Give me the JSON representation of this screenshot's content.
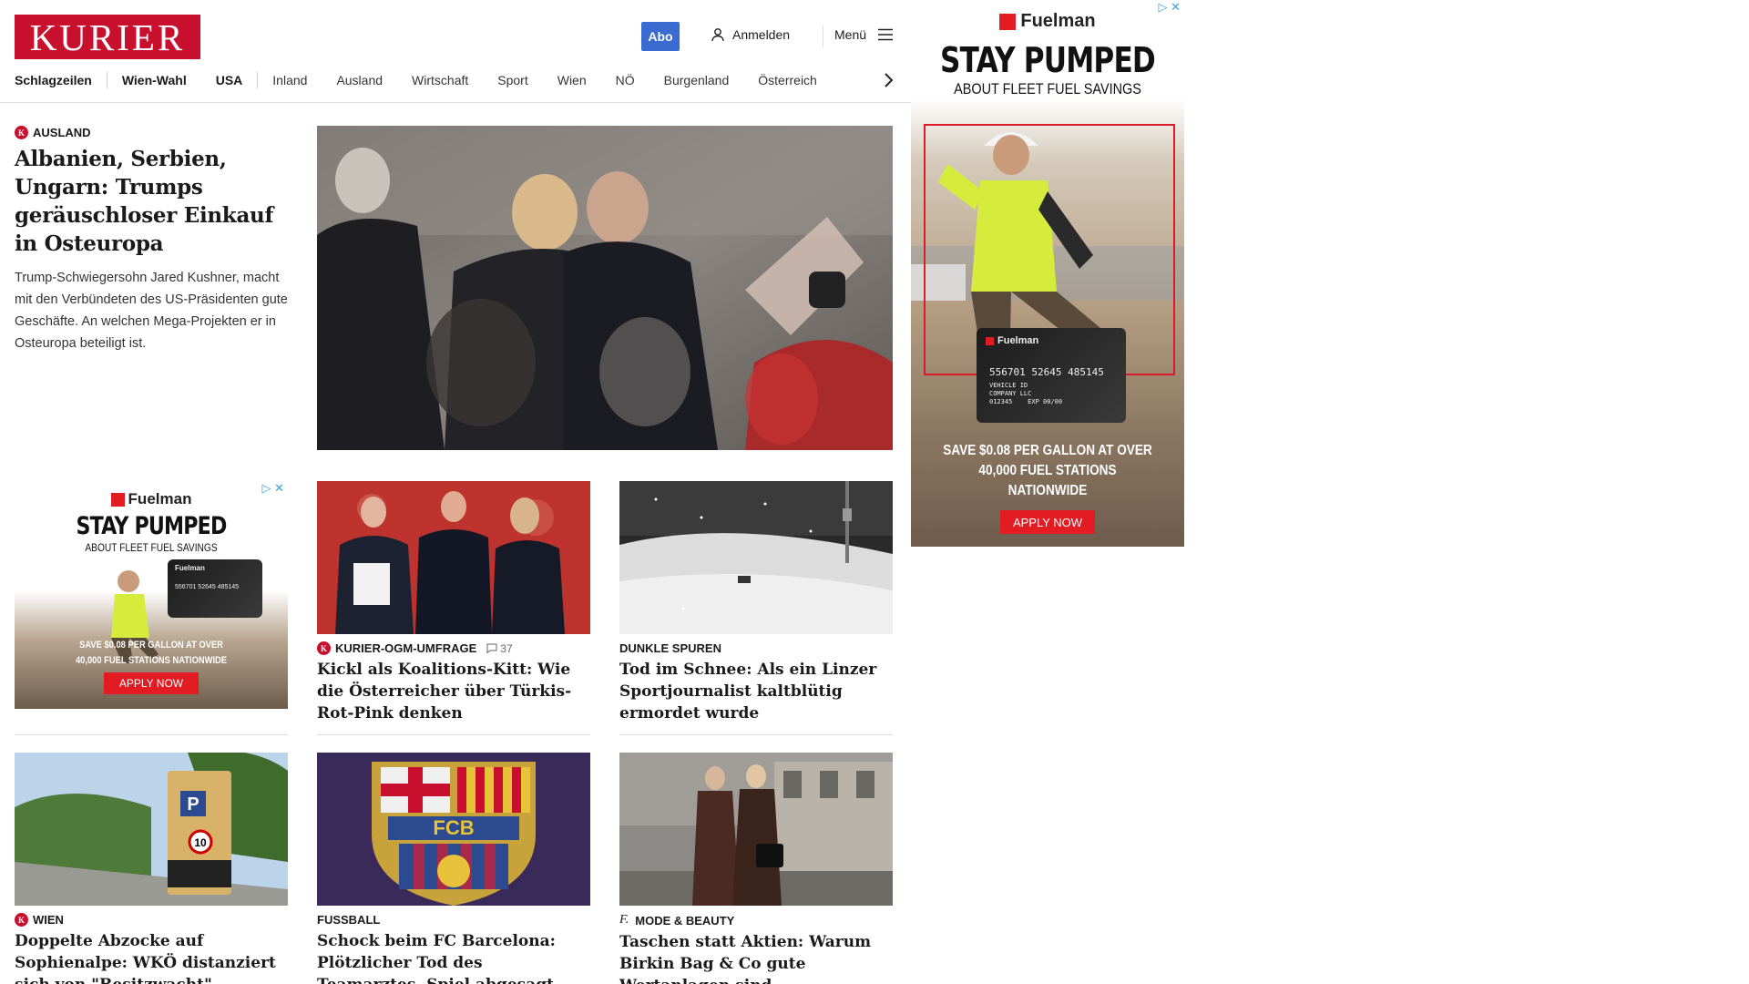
{
  "header": {
    "logo": "KURIER",
    "abo_label": "Abo",
    "login_label": "Anmelden",
    "menu_label": "Menü"
  },
  "nav": {
    "items": [
      "Schlagzeilen",
      "Wien-Wahl",
      "USA",
      "Inland",
      "Ausland",
      "Wirtschaft",
      "Sport",
      "Wien",
      "NÖ",
      "Burgenland",
      "Österreich"
    ]
  },
  "lead": {
    "kicker": "AUSLAND",
    "kicker_icon": "kurier-k-icon",
    "title": "Albanien, Serbien, Ungarn: Trumps geräuschloser Einkauf in Osteuropa",
    "teaser": "Trump-Schwiegersohn Jared Kushner, macht mit den Verbündeten des US-Präsidenten gute Geschäfte. An welchen Mega-Projekten er in Osteuropa beteiligt ist."
  },
  "cards": [
    {
      "kicker": "KURIER-OGM-UMFRAGE",
      "kicker_icon": "kurier-k-icon",
      "comments": "37",
      "title": "Kickl als Koalitions-Kitt: Wie die Österreicher über Türkis-Rot-Pink denken"
    },
    {
      "kicker": "DUNKLE SPUREN",
      "title": "Tod im Schnee: Als ein Linzer Sportjournalist kaltblütig ermordet wurde"
    },
    {
      "kicker": "WIEN",
      "kicker_icon": "kurier-k-icon",
      "title": "Doppelte Abzocke auf Sophienalpe: WKÖ distanziert sich von \"Besitzwacht\""
    },
    {
      "kicker": "FUSSBALL",
      "title": "Schock beim FC Barcelona: Plötzlicher Tod des Teamarztes, Spiel abgesagt"
    },
    {
      "kicker": "MODE & BEAUTY",
      "kicker_icon": "freizeit-f-icon",
      "title": "Taschen statt Aktien: Warum Birkin Bag & Co gute Wertanlagen sind"
    }
  ],
  "ad": {
    "brand": "Fuelman",
    "headline": "STAY PUMPED",
    "subline": "ABOUT FLEET FUEL SAVINGS",
    "offer": "SAVE $0.08 PER GALLON AT OVER 40,000 FUEL STATIONS NATIONWIDE",
    "cta": "APPLY NOW",
    "card_number": "556701  52645  485145",
    "card_line1": "VEHICLE ID",
    "card_line2": "COMPANY LLC",
    "card_line3": "012345",
    "card_exp": "EXP 00/00",
    "brand_color": "#e31b23"
  },
  "colors": {
    "brand": "#c8102e",
    "abo": "#3b6bd1"
  }
}
